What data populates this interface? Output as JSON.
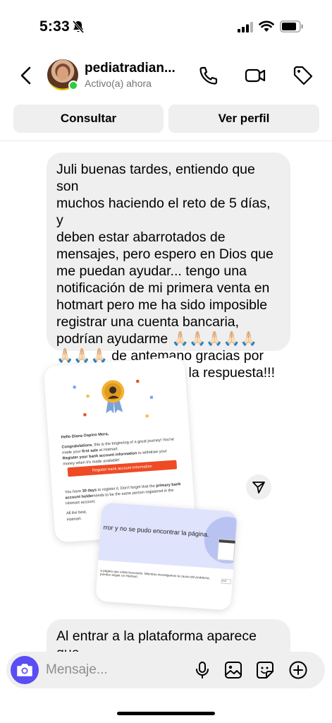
{
  "status_bar": {
    "time": "5:33",
    "icons": [
      "bell-off-icon",
      "signal-icon",
      "wifi-icon",
      "battery-icon"
    ]
  },
  "header": {
    "contact_name": "pediatradian...",
    "contact_status": "Activo(a) ahora",
    "icons": [
      "back-icon",
      "phone-icon",
      "video-icon",
      "tag-icon"
    ]
  },
  "actions": {
    "consult_label": "Consultar",
    "profile_label": "Ver perfil"
  },
  "messages": {
    "first": "Juli buenas tardes, entiendo que son\nmuchos haciendo el reto de 5 días, y\ndeben estar abarrotados de\nmensajes, pero espero en Dios que\nme puedan ayudar... tengo una\nnotificación de mi primera venta en\nhotmart pero me ha sido imposible\nregistrar una cuenta bancaria,\npodrían ayudarme 🙏🏻🙏🏻🙏🏻🙏🏻🙏🏻\n🙏🏻🙏🏻🙏🏻 de antemano gracias por\ntodo lo ofrecido y por la respuesta!!!",
    "second": "Al entrar a la plataforma aparece que\nno se encuentra la página para el"
  },
  "shared_image_1": {
    "greeting": "Hello Diana Ospino Mora,",
    "congrats_bold": "Congratulations",
    "congrats_rest": ", this is the beginning of a great journey! You've made your ",
    "first_sale": "first sale",
    "at_hotmart": " at Hotmart.",
    "register_bold": "Register your bank account information",
    "register_rest": " to withdraw your money when it's made available!",
    "cta": "Register bank account information",
    "days_pre": "You have ",
    "days": "30 days",
    "days_post": " to register it. Don't forget that the ",
    "holder": "primary bank account holder",
    "holder_post": "needs to be the same person registered in the Hotmart account.",
    "signoff_1": "All the best,",
    "signoff_2": "Hotmart."
  },
  "shared_image_2": {
    "error_text": "rror y no se pudo encontrar la página.",
    "sub_text": "a página que estás buscando. Mientras investigamos la causa del problema, puedes seguir en Hotmart.",
    "button": "Volv"
  },
  "composer": {
    "placeholder": "Mensaje...",
    "icons": [
      "camera-icon",
      "microphone-icon",
      "gallery-icon",
      "sticker-icon",
      "add-icon"
    ]
  },
  "colors": {
    "bubble": "#efefef",
    "camera": "#5a4df3",
    "online": "#2ecc40",
    "hotmart_cta": "#ee4a24"
  }
}
